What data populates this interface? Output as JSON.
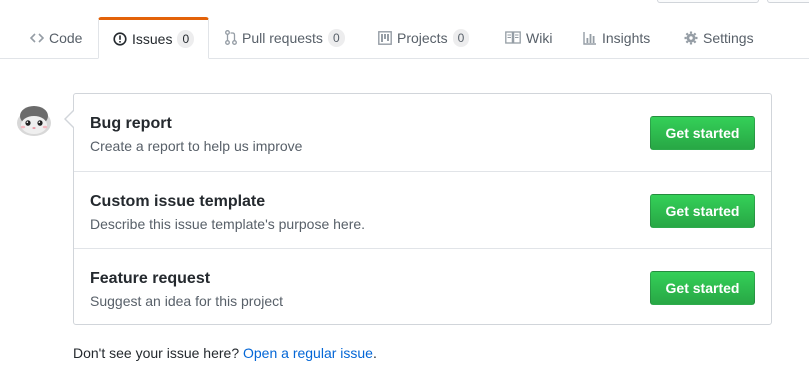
{
  "tabs": [
    {
      "label": "Code",
      "icon": "code-icon"
    },
    {
      "label": "Issues",
      "icon": "issue-opened-icon",
      "count": "0",
      "selected": true
    },
    {
      "label": "Pull requests",
      "icon": "git-pull-request-icon",
      "count": "0"
    },
    {
      "label": "Projects",
      "icon": "project-icon",
      "count": "0"
    },
    {
      "label": "Wiki",
      "icon": "book-icon"
    },
    {
      "label": "Insights",
      "icon": "graph-icon"
    },
    {
      "label": "Settings",
      "icon": "gear-icon"
    }
  ],
  "templates": [
    {
      "title": "Bug report",
      "description": "Create a report to help us improve",
      "button": "Get started"
    },
    {
      "title": "Custom issue template",
      "description": "Describe this issue template's purpose here.",
      "button": "Get started"
    },
    {
      "title": "Feature request",
      "description": "Suggest an idea for this project",
      "button": "Get started"
    }
  ],
  "footer": {
    "prompt": "Don't see your issue here?",
    "link": "Open a regular issue",
    "period": "."
  },
  "colors": {
    "accent": "#e36209",
    "button_green": "#28a745",
    "link": "#0366d6"
  }
}
